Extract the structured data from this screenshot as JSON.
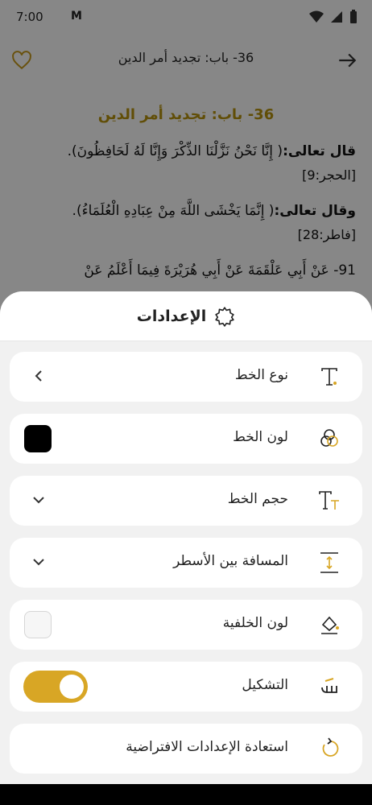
{
  "status": {
    "time": "7:00",
    "mail": "M"
  },
  "appbar": {
    "title": "36- باب: تجديد أمر الدين"
  },
  "content": {
    "chapter_title": "36- باب: تجديد أمر الدين",
    "p1_lead": "قال تعالى:",
    "p1_text": "( إِنَّا نَحْنُ نَزَّلْنَا الذِّكْرَ وَإِنَّا لَهُ لَحَافِظُونَ).",
    "p1_ref": "[الحجر:9]",
    "p2_lead": "وقال تعالى:",
    "p2_text": "( إِنَّمَا يَخْشَى اللَّهَ مِنْ عِبَادِهِ الْعُلَمَاءُ).",
    "p2_ref": "[فاطر:28]",
    "p3_text": "91- عَنْ أَبِي عَلْقَمَةَ عَنْ أَبِي هُرَيْرَةَ فِيمَا أَعْلَمُ عَنْ"
  },
  "settings": {
    "title": "الإعدادات",
    "rows": [
      {
        "label": "نوع الخط",
        "icon": "font-type-icon",
        "control": "chevron"
      },
      {
        "label": "لون الخط",
        "icon": "font-color-icon",
        "control": "swatch",
        "color": "#000000"
      },
      {
        "label": "حجم الخط",
        "icon": "font-size-icon",
        "control": "dropdown"
      },
      {
        "label": "المسافة بين الأسطر",
        "icon": "line-spacing-icon",
        "control": "dropdown"
      },
      {
        "label": "لون الخلفية",
        "icon": "background-color-icon",
        "control": "swatch",
        "color": "#f6f6f6"
      },
      {
        "label": "التشكيل",
        "icon": "diacritics-icon",
        "control": "toggle",
        "on": true
      },
      {
        "label": "استعادة الإعدادات الافتراضية",
        "icon": "reset-icon",
        "control": "none"
      }
    ]
  },
  "colors": {
    "accent": "#d8a625",
    "chapter_title": "#b8930e"
  }
}
